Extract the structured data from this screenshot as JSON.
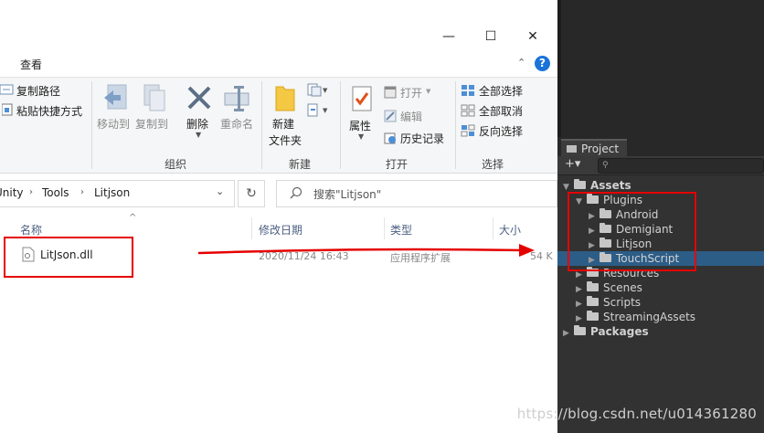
{
  "explorer": {
    "menu": {
      "view": "查看"
    },
    "window_controls": {
      "minimize": "—",
      "maximize": "☐",
      "close": "✕"
    },
    "ribbon": {
      "copy_path": "复制路径",
      "paste_shortcut": "粘贴快捷方式",
      "move_to": "移动到",
      "copy_to": "复制到",
      "delete": "删除",
      "rename": "重命名",
      "new_folder_1": "新建",
      "new_folder_2": "文件夹",
      "properties": "属性",
      "open": "打开",
      "edit": "编辑",
      "history": "历史记录",
      "select_all": "全部选择",
      "select_none": "全部取消",
      "invert_selection": "反向选择",
      "group_organize": "组织",
      "group_new": "新建",
      "group_open": "打开",
      "group_select": "选择"
    },
    "address": {
      "crumbs": [
        "Unity",
        "Tools",
        "Litjson"
      ],
      "search_placeholder": "搜索\"Litjson\""
    },
    "columns": {
      "name": "名称",
      "date": "修改日期",
      "type": "类型",
      "size": "大小"
    },
    "files": [
      {
        "name": "LitJson.dll",
        "date": "2020/11/24 16:43",
        "type": "应用程序扩展",
        "size": "54 K"
      }
    ]
  },
  "unity": {
    "tab": "Project",
    "toolbar": {
      "add": "+▾"
    },
    "tree": [
      {
        "label": "Assets",
        "depth": 0,
        "expanded": true,
        "bold": true
      },
      {
        "label": "Plugins",
        "depth": 1,
        "expanded": true
      },
      {
        "label": "Android",
        "depth": 2
      },
      {
        "label": "Demigiant",
        "depth": 2
      },
      {
        "label": "Litjson",
        "depth": 2
      },
      {
        "label": "TouchScript",
        "depth": 2,
        "selected": true
      },
      {
        "label": "Resources",
        "depth": 1
      },
      {
        "label": "Scenes",
        "depth": 1
      },
      {
        "label": "Scripts",
        "depth": 1
      },
      {
        "label": "StreamingAssets",
        "depth": 1
      },
      {
        "label": "Packages",
        "depth": 0,
        "bold": true
      }
    ]
  },
  "watermark": "https://blog.csdn.net/u014361280",
  "colors": {
    "annotation_red": "#e50000",
    "selection_blue": "#2c5d87",
    "help_blue": "#1a73d9"
  }
}
